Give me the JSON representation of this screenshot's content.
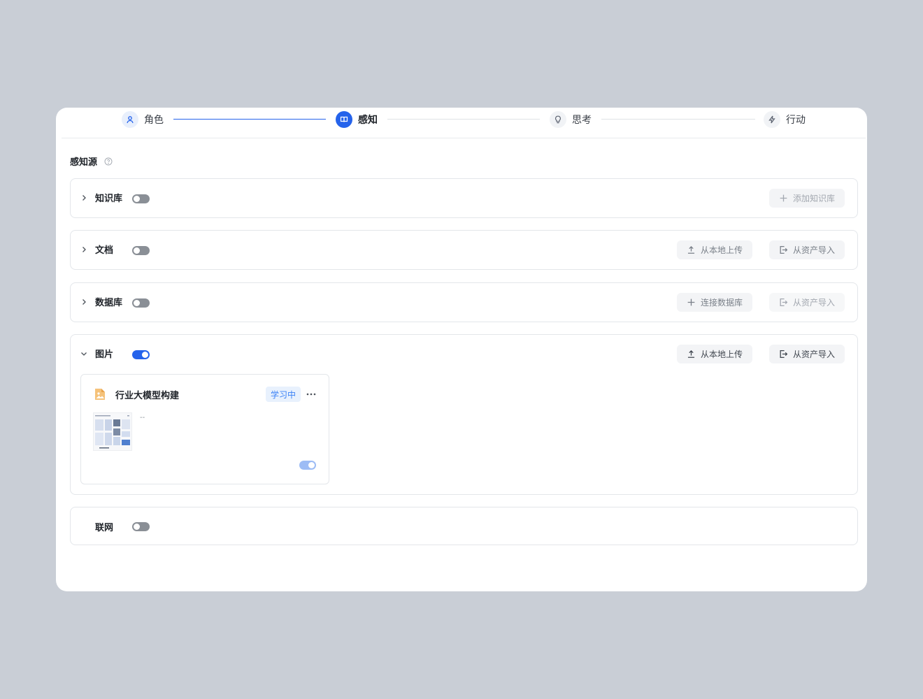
{
  "stepper": {
    "steps": [
      {
        "label": "角色",
        "state": "done",
        "icon": "user-icon"
      },
      {
        "label": "感知",
        "state": "active",
        "icon": "book-icon"
      },
      {
        "label": "思考",
        "state": "pending",
        "icon": "lightbulb-icon"
      },
      {
        "label": "行动",
        "state": "pending",
        "icon": "lightning-icon"
      }
    ]
  },
  "perception": {
    "title": "感知源",
    "sections": {
      "knowledge": {
        "label": "知识库",
        "enabled": false,
        "expanded": false,
        "add_button": "添加知识库"
      },
      "document": {
        "label": "文档",
        "enabled": false,
        "expanded": false,
        "upload_button": "从本地上传",
        "import_button": "从资产导入"
      },
      "database": {
        "label": "数据库",
        "enabled": false,
        "expanded": false,
        "connect_button": "连接数据库",
        "import_button": "从资产导入"
      },
      "image": {
        "label": "图片",
        "enabled": true,
        "expanded": true,
        "upload_button": "从本地上传",
        "import_button": "从资产导入",
        "items": [
          {
            "title": "行业大模型构建",
            "status": "学习中",
            "description": "--",
            "enabled": true
          }
        ]
      },
      "web": {
        "label": "联网",
        "enabled": false
      }
    }
  },
  "colors": {
    "accent": "#2563eb",
    "background": "#c9ced6",
    "badge_bg": "#e8f1fd",
    "badge_text": "#3b82f6"
  }
}
